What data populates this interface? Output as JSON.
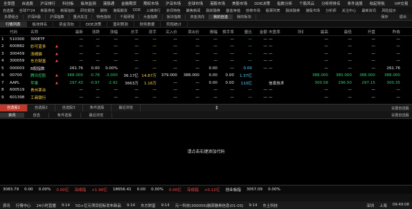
{
  "menubar": {
    "items": [
      {
        "label": "全景图",
        "red": false
      },
      {
        "label": "自选股",
        "red": false
      },
      {
        "label": "沪深排行",
        "red": false
      },
      {
        "label": "科创板",
        "red": false
      },
      {
        "label": "板块监测",
        "red": false
      },
      {
        "label": "港股通",
        "red": false
      },
      {
        "label": "金融期货",
        "red": false
      },
      {
        "label": "期权市场",
        "red": false
      },
      {
        "label": "沪深市场",
        "red": false
      },
      {
        "label": "全球市场",
        "red": false
      },
      {
        "label": "港股市场",
        "red": false
      },
      {
        "label": "美股市场",
        "red": false
      },
      {
        "label": "DDE决策",
        "red": false
      },
      {
        "label": "指数分析",
        "red": false
      },
      {
        "label": "个股风云",
        "red": false
      },
      {
        "label": "分析师排名",
        "red": false
      },
      {
        "label": "条件选股",
        "red": false
      }
    ],
    "right": [
      "收起导航",
      "VIP交易",
      "L2交易"
    ]
  },
  "toolbar2": {
    "items": [
      "自选股",
      "全球7*24",
      "新股排名",
      "新股指标",
      "研究报告",
      "期权",
      "港股期货",
      "DDE",
      "三维排行",
      "资讯特色",
      "聚焦新闻",
      "融资融券",
      "基金净值",
      "债券市场",
      "股票列表",
      "融资融券",
      "港股市场",
      "分析师",
      "关注中心",
      "最新资讯",
      "风险提示"
    ]
  },
  "toolbar3": {
    "tabs": [
      "多屏组合",
      "沪深A股",
      "沪深指数",
      "重点关注",
      "特色指标",
      "个股研报",
      "大盘指数",
      "板块指数",
      "资金流向",
      "我的自选",
      "我的板块"
    ],
    "active": 9,
    "right": [
      "保存",
      "退出"
    ]
  },
  "toolbar4": {
    "tabs": [
      "行情列表",
      "板块排名",
      "资金流向",
      "DDE决策",
      "盈利预测",
      "财务数据",
      "阶段统计"
    ],
    "active": 0
  },
  "table": {
    "headers": [
      "",
      "代码",
      "名称",
      "",
      "最新",
      "涨跌",
      "涨幅",
      "总手",
      "现手",
      "买入价",
      "卖出价",
      "振幅",
      "换手率",
      "量比",
      "金额",
      "市盈率",
      "所属行业",
      "最高",
      "最低",
      "开盘",
      "昨收"
    ],
    "rows": [
      {
        "idx": "1",
        "code": "510300",
        "name": "300ETF",
        "flag": "",
        "latest": "—",
        "chg": "—",
        "pct": "—",
        "vol": "—",
        "cur": "—",
        "bid": "—",
        "ask": "—",
        "amp": "—",
        "turn": "—",
        "vr": "—",
        "amt": "—",
        "pe": "—",
        "ind": "",
        "high": "—",
        "low": "—",
        "open": "—",
        "prev": "—",
        "color": "wht"
      },
      {
        "idx": "2",
        "code": "600882",
        "name": "妙可蓝多",
        "flag": "▲",
        "latest": "—",
        "chg": "—",
        "pct": "—",
        "vol": "—",
        "cur": "—",
        "bid": "—",
        "ask": "—",
        "amp": "—",
        "turn": "—",
        "vr": "—",
        "amt": "—",
        "pe": "—",
        "ind": "",
        "high": "—",
        "low": "—",
        "open": "—",
        "prev": "—",
        "color": "yel"
      },
      {
        "idx": "3",
        "code": "300459",
        "name": "汤姆猫",
        "flag": "▲",
        "latest": "—",
        "chg": "—",
        "pct": "—",
        "vol": "—",
        "cur": "—",
        "bid": "—",
        "ask": "—",
        "amp": "—",
        "turn": "—",
        "vr": "—",
        "amt": "—",
        "pe": "—",
        "ind": "",
        "high": "—",
        "low": "—",
        "open": "—",
        "prev": "—",
        "color": "yel"
      },
      {
        "idx": "4",
        "code": "300059",
        "name": "东方财富",
        "flag": "▲",
        "latest": "—",
        "chg": "—",
        "pct": "—",
        "vol": "—",
        "cur": "—",
        "bid": "—",
        "ask": "—",
        "amp": "—",
        "turn": "—",
        "vr": "—",
        "amt": "—",
        "pe": "—",
        "ind": "",
        "high": "—",
        "low": "—",
        "open": "—",
        "prev": "—",
        "color": "yel"
      },
      {
        "idx": "5",
        "code": "000003",
        "name": "B股指数",
        "flag": "",
        "latest": "261.76",
        "chg": "0.00",
        "pct": "0.00%",
        "vol": "—",
        "cur": "—",
        "bid": "—",
        "ask": "—",
        "amp": "0.00",
        "turn": "—",
        "vr": "0.00",
        "amt": "—",
        "pe": "—",
        "ind": "",
        "high": "—",
        "low": "—",
        "open": "—",
        "prev": "261.76",
        "color": "wht"
      },
      {
        "idx": "6",
        "code": "00700",
        "name": "腾讯控股",
        "flag": "▲",
        "latest": "388.000",
        "chg": "-0.78",
        "pct": "-3.000",
        "vol": "36.17亿",
        "cur": "14.87万",
        "bid": "379.000",
        "ask": "388.000",
        "amp": "0.00",
        "turn": "0.00",
        "vr": "1.37亿",
        "amt": "",
        "pe": "",
        "ind": "",
        "high": "388.000",
        "low": "380.000",
        "open": "388.000",
        "prev": "388.000",
        "color": "grn"
      },
      {
        "idx": "7",
        "code": "AAPL",
        "name": "苹果",
        "flag": "▲",
        "latest": "297.43",
        "chg": "-0.97",
        "pct": "-2.92",
        "vol": "3663万",
        "cur": "1.16万",
        "bid": "—",
        "ask": "—",
        "amp": "0.00",
        "turn": "0.00",
        "vr": "110亿",
        "amt": "",
        "pe": "信息技术",
        "ind": "",
        "high": "300.58",
        "low": "296.50",
        "open": "297.15",
        "prev": "300.35",
        "color": "grn"
      },
      {
        "idx": "8",
        "code": "600519",
        "name": "贵州茅台",
        "flag": "",
        "latest": "—",
        "chg": "—",
        "pct": "—",
        "vol": "—",
        "cur": "—",
        "bid": "—",
        "ask": "—",
        "amp": "—",
        "turn": "—",
        "vr": "—",
        "amt": "—",
        "pe": "—",
        "ind": "",
        "high": "—",
        "low": "—",
        "open": "—",
        "prev": "—",
        "color": "yel"
      },
      {
        "idx": "9",
        "code": "601398",
        "name": "工商银行",
        "flag": "",
        "latest": "—",
        "chg": "—",
        "pct": "—",
        "vol": "—",
        "cur": "—",
        "bid": "—",
        "ask": "—",
        "amp": "—",
        "turn": "—",
        "vr": "—",
        "amt": "—",
        "pe": "—",
        "ind": "",
        "high": "—",
        "low": "—",
        "open": "—",
        "prev": "—",
        "color": "yel"
      }
    ]
  },
  "lower_tabs": {
    "tabs": [
      "自选股1",
      "自选股2",
      "自选股3",
      "条件选股",
      "最近浏览"
    ],
    "active": 0,
    "right": "设置自选股"
  },
  "lower_tabs2": {
    "tabs": [
      "资讯",
      "自选",
      "条件选股",
      "最近浏览"
    ],
    "active": 0,
    "right": "设置自选股"
  },
  "empty_message": "请点击右键添加代码",
  "indexbar": {
    "sh_value": "3083.79",
    "sh_chg": "0.00",
    "sh_pct": "0.00%",
    "sh_amt": "0.00亿",
    "sz_label": "深成指",
    "sz_tag": "+1.90亿",
    "sz_value": "18656.41",
    "sz_chg": "0.00",
    "sz_pct": "0.00%",
    "sz_amt": "0.00亿",
    "cy_label": "深成指",
    "cy_tag": "+0.12亿",
    "cy_label2": "创业板指",
    "cy_value": "3057.09",
    "cy_pct": "0.00%"
  },
  "statusbar": {
    "items": [
      "资讯",
      "行情中心",
      "24小时直播",
      "9:14",
      "5G+亿元项目招标发布新品",
      "9:14",
      "东方财富",
      "9:14",
      "元一科技(300056)融资融券信息(01-03)",
      "9:14",
      "东土科技"
    ],
    "right": [
      "深圳",
      "上海",
      "09:49:08"
    ]
  }
}
